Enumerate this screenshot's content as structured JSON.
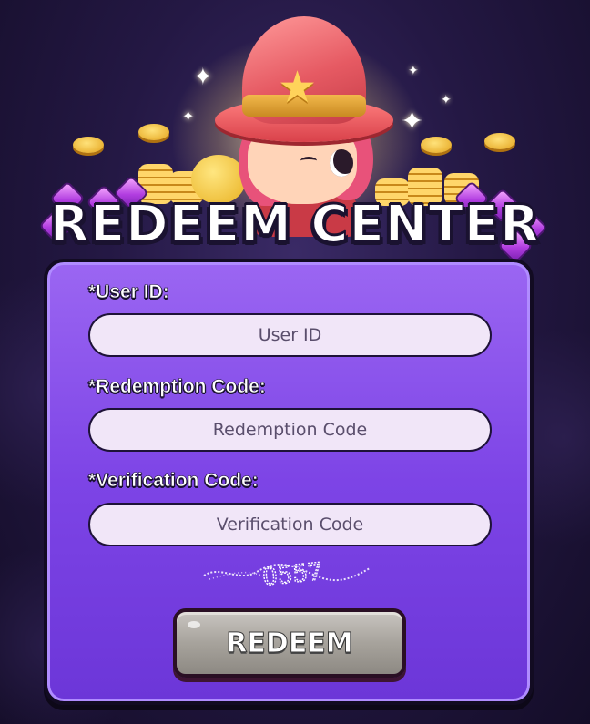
{
  "header": {
    "title": "REDEEM CENTER",
    "art_icon": "wizard-mascot-icon"
  },
  "form": {
    "user_id": {
      "label": "*User ID:",
      "placeholder": "User ID",
      "value": ""
    },
    "redemption_code": {
      "label": "*Redemption Code:",
      "placeholder": "Redemption Code",
      "value": ""
    },
    "verification_code": {
      "label": "*Verification Code:",
      "placeholder": "Verification Code",
      "value": ""
    },
    "captcha_text": "0557",
    "submit_label": "REDEEM"
  },
  "colors": {
    "panel": "#7d44e6",
    "panel_border": "#120b22",
    "input_bg": "#f1e6f8",
    "button": "#a7a39c"
  }
}
